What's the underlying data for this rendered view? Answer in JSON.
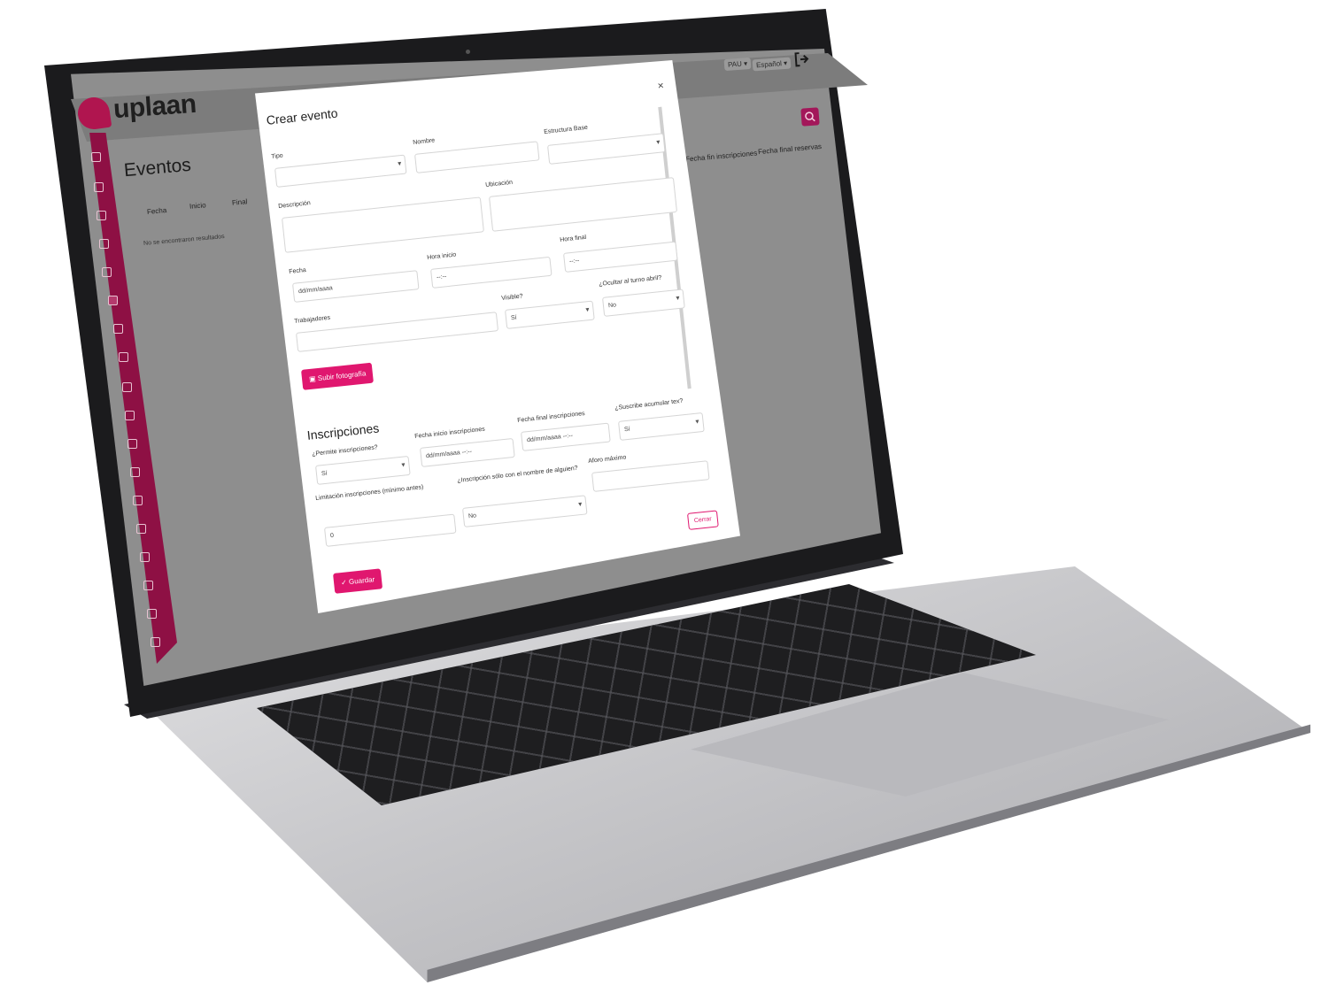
{
  "app": {
    "brand": "uplaan",
    "brand_color": "#e0176f",
    "page_title": "Eventos",
    "top_menus": [
      "PAU ▾",
      "Español ▾"
    ],
    "table_headers": [
      "Fecha",
      "Inicio",
      "Final"
    ],
    "table_headers_right": [
      "Fecha fin inscripciones",
      "Fecha final reservas"
    ],
    "empty_message": "No se encontraron resultados",
    "search_placeholder": "Buscar"
  },
  "modal": {
    "title": "Crear evento",
    "close_symbol": "×",
    "fields": {
      "tipo": {
        "label": "Tipo",
        "value": ""
      },
      "nombre": {
        "label": "Nombre",
        "value": ""
      },
      "estructura": {
        "label": "Estructura Base",
        "value": ""
      },
      "descripcion": {
        "label": "Descripción",
        "value": ""
      },
      "ubicacion": {
        "label": "Ubicación",
        "value": ""
      },
      "fecha": {
        "label": "Fecha",
        "placeholder": "dd/mm/aaaa"
      },
      "hora_inicio": {
        "label": "Hora inicio",
        "placeholder": "--:--"
      },
      "hora_final": {
        "label": "Hora final",
        "placeholder": "--:--"
      },
      "trabajadores": {
        "label": "Trabajadores",
        "value": ""
      },
      "visible": {
        "label": "Visible?",
        "value": "Sí"
      },
      "ocultar_turno": {
        "label": "¿Ocultar al turno abril?",
        "value": "No"
      }
    },
    "upload_button": "Subir fotografía",
    "inscripciones": {
      "heading": "Inscripciones",
      "permite": {
        "label": "¿Permite inscripciones?",
        "value": "Sí"
      },
      "fecha_inicio": {
        "label": "Fecha inicio inscripciones",
        "placeholder": "dd/mm/aaaa --:--"
      },
      "fecha_final": {
        "label": "Fecha final inscripciones",
        "placeholder": "dd/mm/aaaa --:--"
      },
      "acumular": {
        "label": "¿Suscribe acumular tex?",
        "value": "Sí"
      },
      "limitacion": {
        "label": "Limitación inscripciones (mínimo antes)",
        "value": "0"
      },
      "solo_nombre": {
        "label": "¿Inscripción sólo con el nombre de alguien?",
        "value": "No"
      },
      "aforo": {
        "label": "Aforo máximo",
        "value": ""
      }
    },
    "cancel_button": "Cerrar",
    "save_button": "✓ Guardar"
  }
}
